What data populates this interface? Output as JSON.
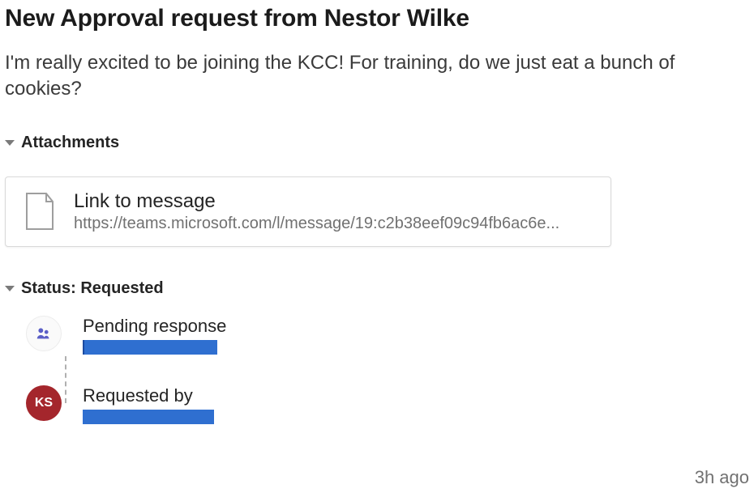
{
  "title": "New Approval request from Nestor Wilke",
  "body": "I'm really excited to be joining the KCC! For training, do we just eat a bunch of cookies?",
  "attachments": {
    "section_label": "Attachments",
    "card": {
      "title": "Link to message",
      "url": "https://teams.microsoft.com/l/message/19:c2b38eef09c94fb6ac6e..."
    }
  },
  "status": {
    "section_label": "Status: Requested",
    "items": [
      {
        "label": "Pending response",
        "avatar_type": "generic"
      },
      {
        "label": "Requested by",
        "avatar_type": "initials",
        "initials": "KS"
      }
    ]
  },
  "timestamp": "3h ago"
}
